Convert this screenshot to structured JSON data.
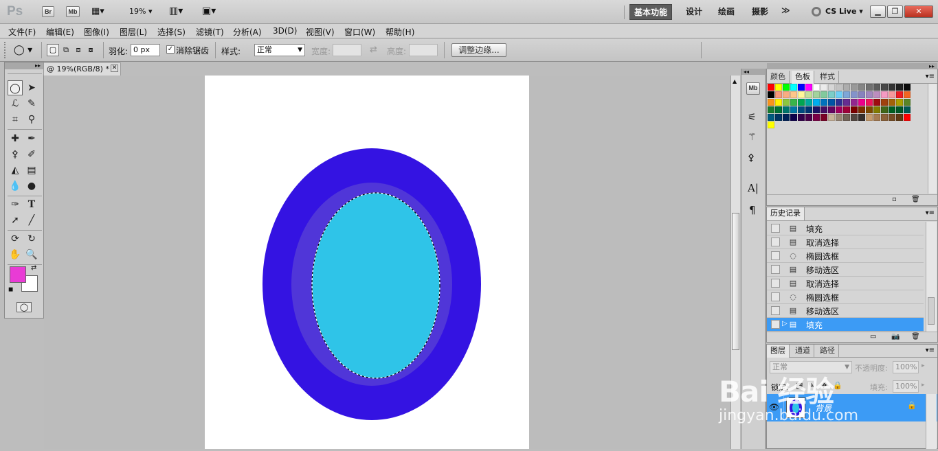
{
  "app": {
    "logo": "Ps",
    "bridge": "Br",
    "mini": "Mb",
    "zoom": "19%",
    "workspaces": [
      "基本功能",
      "设计",
      "绘画",
      "摄影"
    ],
    "more": "≫",
    "cs_live": "CS Live"
  },
  "menu": [
    "文件(F)",
    "编辑(E)",
    "图像(I)",
    "图层(L)",
    "选择(S)",
    "滤镜(T)",
    "分析(A)",
    "3D(D)",
    "视图(V)",
    "窗口(W)",
    "帮助(H)"
  ],
  "options": {
    "feather_label": "羽化:",
    "feather_value": "0 px",
    "antialias_label": "消除锯齿",
    "style_label": "样式:",
    "style_value": "正常",
    "width_label": "宽度:",
    "height_label": "高度:",
    "refine_button": "调整边缘..."
  },
  "document": {
    "tab_title": "@ 19%(RGB/8) *"
  },
  "colors": {
    "foreground": "#e93bd5",
    "background": "#ffffff",
    "outer_ring": "#3413e2",
    "middle_ring": "#5036d8",
    "inner_fill": "#2fc4e8"
  },
  "swatches_panel": {
    "tabs": [
      "颜色",
      "色板",
      "样式"
    ],
    "active": "色板"
  },
  "history_panel": {
    "title": "历史记录",
    "items": [
      {
        "label": "填充",
        "icon": "fill-icon"
      },
      {
        "label": "取消选择",
        "icon": "deselect-icon"
      },
      {
        "label": "椭圆选框",
        "icon": "ellipse-marquee-icon"
      },
      {
        "label": "移动选区",
        "icon": "move-selection-icon"
      },
      {
        "label": "取消选择",
        "icon": "deselect-icon"
      },
      {
        "label": "椭圆选框",
        "icon": "ellipse-marquee-icon"
      },
      {
        "label": "移动选区",
        "icon": "move-selection-icon"
      },
      {
        "label": "填充",
        "icon": "fill-icon"
      }
    ],
    "selected_index": 7
  },
  "layers_panel": {
    "tabs": [
      "图层",
      "通道",
      "路径"
    ],
    "blend_mode": "正常",
    "opacity_label": "不透明度:",
    "opacity": "100%",
    "lock_label": "锁定:",
    "fill_label": "填充:",
    "fill": "100%",
    "layer_name": "背景"
  },
  "watermark": {
    "brand": "Bai 经验",
    "url": "jingyan.baidu.com"
  }
}
